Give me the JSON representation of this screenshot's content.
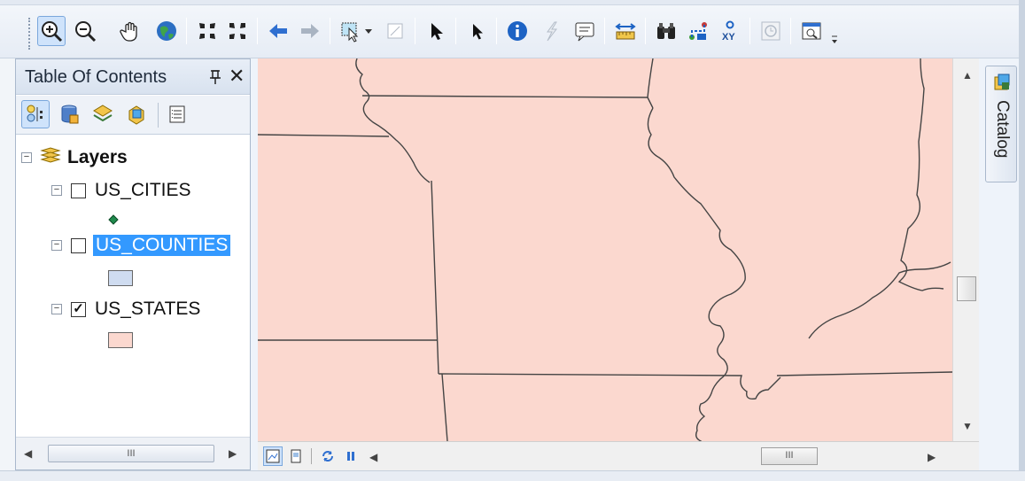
{
  "toolbar": {
    "tools": [
      {
        "name": "zoom-in-icon"
      },
      {
        "name": "zoom-out-icon"
      },
      {
        "name": "pan-icon"
      },
      {
        "name": "full-extent-icon"
      },
      {
        "name": "fixed-zoom-in-icon"
      },
      {
        "name": "fixed-zoom-out-icon"
      },
      {
        "name": "back-extent-icon"
      },
      {
        "name": "forward-extent-icon"
      },
      {
        "name": "select-features-icon"
      },
      {
        "name": "clear-selection-icon"
      },
      {
        "name": "select-elements-icon"
      },
      {
        "name": "select-cursor-icon"
      },
      {
        "name": "identify-icon"
      },
      {
        "name": "hyperlink-icon"
      },
      {
        "name": "html-popup-icon"
      },
      {
        "name": "measure-icon"
      },
      {
        "name": "find-icon"
      },
      {
        "name": "find-route-icon"
      },
      {
        "name": "go-to-xy-icon"
      },
      {
        "name": "time-slider-icon"
      },
      {
        "name": "create-viewer-icon"
      }
    ],
    "xy_label": "XY"
  },
  "toc": {
    "title": "Table Of Contents",
    "pin_icon": "pin-icon",
    "close_glyph": "✕",
    "root": {
      "label": "Layers",
      "expander": "⊟"
    },
    "layers": [
      {
        "label": "US_CITIES",
        "checked": false,
        "expander": "⊟",
        "selected": false,
        "symbol": "point",
        "symbol_color": "#1f8a4c"
      },
      {
        "label": "US_COUNTIES",
        "checked": false,
        "expander": "⊟",
        "selected": true,
        "symbol": "polygon",
        "symbol_color": "#cfdcf0"
      },
      {
        "label": "US_STATES",
        "checked": true,
        "expander": "⊟",
        "selected": false,
        "symbol": "polygon",
        "symbol_color": "#fbd8cf"
      }
    ],
    "scroll_thumb_label": "III"
  },
  "map": {
    "fill_color": "#fbd8cf",
    "line_color": "#444444",
    "scroll_thumb_label": "III"
  },
  "catalog": {
    "label": "Catalog"
  }
}
